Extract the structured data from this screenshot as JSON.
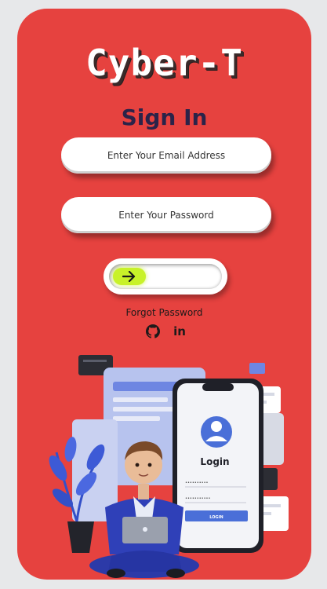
{
  "brand": {
    "name": "Cyber-T"
  },
  "form": {
    "heading": "Sign In",
    "email_placeholder": "Enter Your Email Address",
    "password_placeholder": "Enter Your Password",
    "forgot_label": "Forgot Password"
  },
  "socials": {
    "items": [
      {
        "icon": "github-icon"
      },
      {
        "icon": "linkedin-icon",
        "glyph": "in"
      }
    ]
  },
  "illustration": {
    "login_title": "Login",
    "login_button": "LOGIN",
    "email_mask": "••••••••••",
    "password_mask": "•••••••••••"
  },
  "colors": {
    "background": "#e7e8ea",
    "card": "#e6423f",
    "heading": "#2b2349",
    "accent": "#c8f229",
    "phone_button": "#4a6fd8"
  }
}
